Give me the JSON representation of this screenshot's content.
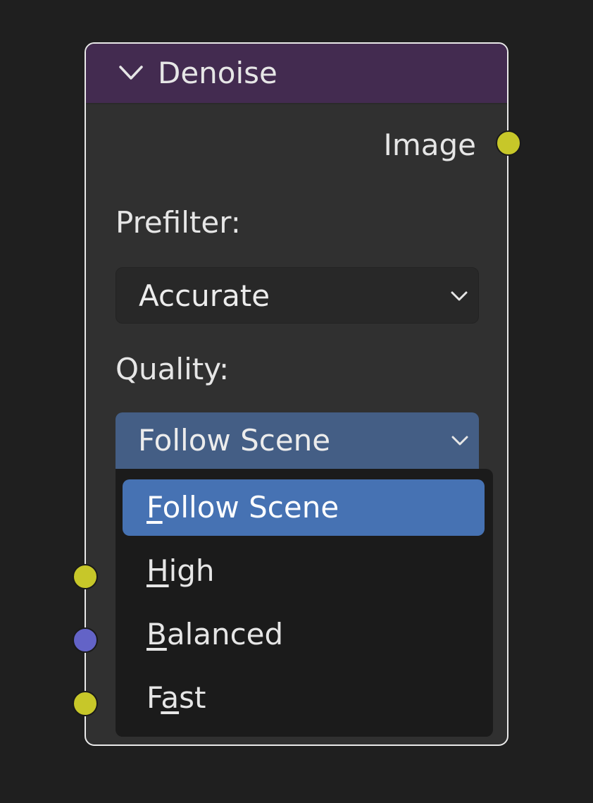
{
  "node": {
    "title": "Denoise",
    "output_socket_label": "Image",
    "colors": {
      "header": "#432b50",
      "body": "#303030",
      "selected_outline": "#e9e9e9",
      "socket_color": "#c7c729",
      "socket_float": "#6363c7",
      "dropdown_active": "#445e85",
      "menu_highlight": "#4672b3"
    }
  },
  "prefilter": {
    "label": "Prefilter:",
    "value": "Accurate"
  },
  "quality": {
    "label": "Quality:",
    "value": "Follow Scene",
    "options": [
      {
        "before": "",
        "key": "F",
        "after": "ollow Scene",
        "selected": true
      },
      {
        "before": "",
        "key": "H",
        "after": "igh",
        "selected": false
      },
      {
        "before": "",
        "key": "B",
        "after": "alanced",
        "selected": false
      },
      {
        "before": "F",
        "key": "a",
        "after": "st",
        "selected": false
      }
    ]
  },
  "icons": {
    "collapse": "chevron-down-icon",
    "dropdown": "chevron-down-icon"
  }
}
